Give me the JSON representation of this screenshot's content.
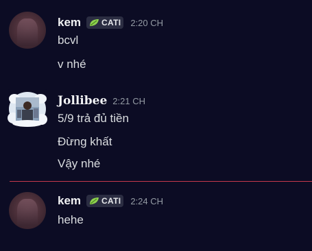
{
  "messages": [
    {
      "username": "kem",
      "tag": "CATI",
      "timestamp": "2:20 CH",
      "lines": [
        "bcvl",
        "v nhé"
      ]
    },
    {
      "username": "Jollibee",
      "timestamp": "2:21 CH",
      "lines": [
        "5/9 trả đủ tiền",
        "Đừng khất",
        "Vậy nhé"
      ]
    },
    {
      "username": "kem",
      "tag": "CATI",
      "timestamp": "2:24 CH",
      "lines": [
        "hehe"
      ]
    }
  ],
  "colors": {
    "background": "#0c0c24",
    "new_message_divider": "#c6394c",
    "tag_leaf": "#8fd14f"
  }
}
